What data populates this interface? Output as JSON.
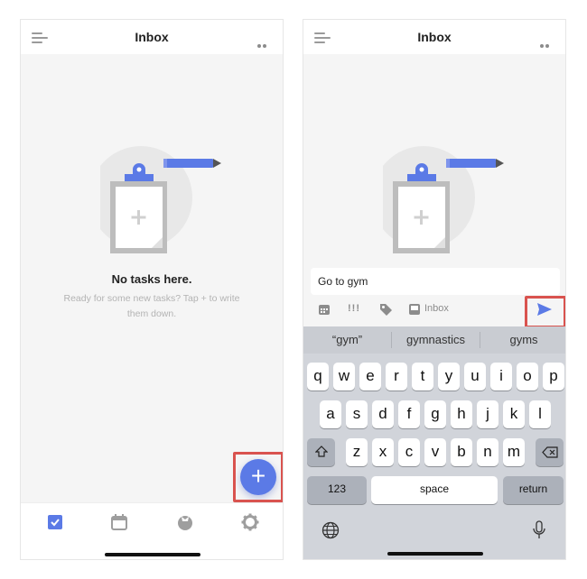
{
  "left": {
    "title": "Inbox",
    "empty_title": "No tasks here.",
    "empty_subtitle": "Ready for some new tasks? Tap + to write them down.",
    "fab_label": "+",
    "tabs": [
      "checkbox-icon",
      "calendar-icon",
      "pomodoro-icon",
      "settings-icon"
    ]
  },
  "right": {
    "title": "Inbox",
    "task_input_value": "Go to gym",
    "toolbar": {
      "priority_label": "!!!",
      "list_label": "Inbox"
    },
    "suggestions": [
      "“gym”",
      "gymnastics",
      "gyms"
    ],
    "keyboard": {
      "row1": [
        "q",
        "w",
        "e",
        "r",
        "t",
        "y",
        "u",
        "i",
        "o",
        "p"
      ],
      "row2": [
        "a",
        "s",
        "d",
        "f",
        "g",
        "h",
        "j",
        "k",
        "l"
      ],
      "row3": [
        "z",
        "x",
        "c",
        "v",
        "b",
        "n",
        "m"
      ],
      "numbers_key": "123",
      "space_key": "space",
      "return_key": "return"
    }
  },
  "colors": {
    "accent": "#5b7ae6",
    "highlight": "#d9534f",
    "background": "#f5f5f5"
  }
}
